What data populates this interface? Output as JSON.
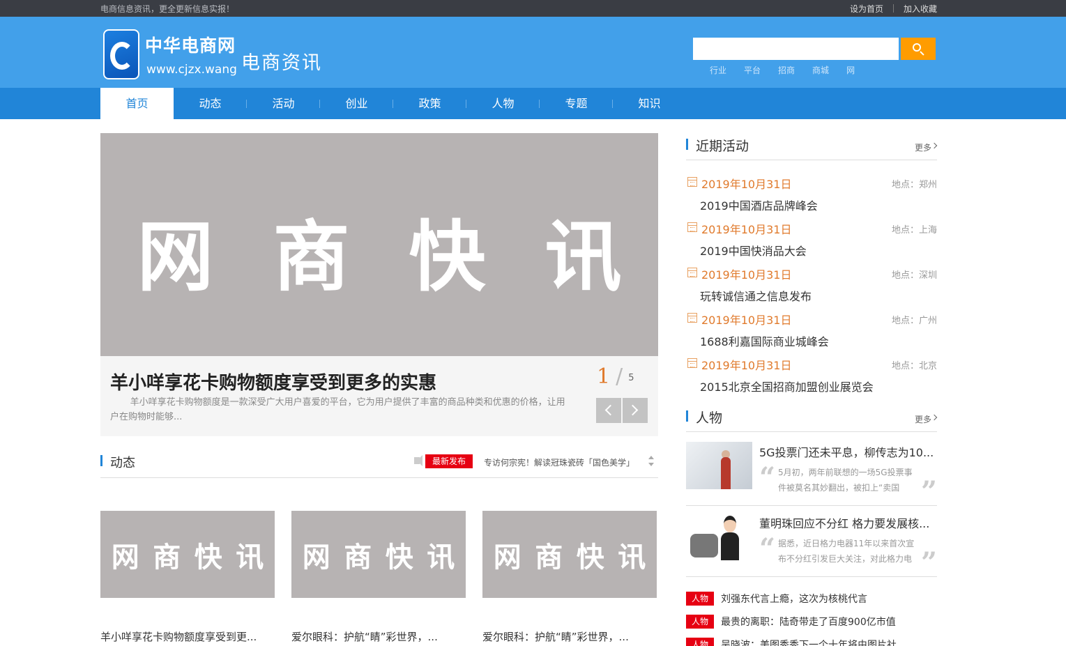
{
  "topbar": {
    "slogan": "电商信息资讯，更全更新信息实报！",
    "set_home": "设为首页",
    "add_fav": "加入收藏"
  },
  "header": {
    "logo_name": "中华电商网",
    "logo_url": "www.cjzx.wang",
    "section": "电商资讯",
    "search_placeholder": "",
    "hot_words": [
      "行业",
      "平台",
      "招商",
      "商城",
      "网"
    ]
  },
  "nav": [
    "首页",
    "动态",
    "活动",
    "创业",
    "政策",
    "人物",
    "专题",
    "知识"
  ],
  "banner": {
    "image_text": [
      "网",
      "商",
      "快",
      "讯"
    ],
    "title": "羊小咩享花卡购物额度享受到更多的实惠",
    "desc": "羊小咩享花卡购物额度是一款深受广大用户喜爱的平台，它为用户提供了丰富的商品种类和优惠的价格，让用户在购物时能够...",
    "current": "1",
    "slash": "/",
    "total": "5"
  },
  "dongtai": {
    "title": "动态",
    "badge": "最新发布",
    "ticker": "专访何宗宪！解读冠珠瓷砖「国色美学」",
    "cards": [
      {
        "img": [
          "网",
          "商",
          "快",
          "讯"
        ],
        "title": "羊小咩享花卡购物额度享受到更..."
      },
      {
        "img": [
          "网",
          "商",
          "快",
          "讯"
        ],
        "title": "爱尔眼科：护航“睛”彩世界，..."
      },
      {
        "img": [
          "网",
          "商",
          "快",
          "讯"
        ],
        "title": "爱尔眼科：护航“睛”彩世界，..."
      }
    ]
  },
  "events": {
    "title": "近期活动",
    "more": "更多",
    "items": [
      {
        "date": "2019年10月31日",
        "loc": "地点：郑州",
        "title": "2019中国酒店品牌峰会"
      },
      {
        "date": "2019年10月31日",
        "loc": "地点：上海",
        "title": "2019中国快消品大会"
      },
      {
        "date": "2019年10月31日",
        "loc": "地点：深圳",
        "title": "玩转诚信通之信息发布"
      },
      {
        "date": "2019年10月31日",
        "loc": "地点：广州",
        "title": "1688利嘉国际商业城峰会"
      },
      {
        "date": "2019年10月31日",
        "loc": "地点：北京",
        "title": "2015北京全国招商加盟创业展览会"
      }
    ]
  },
  "people": {
    "title": "人物",
    "more": "更多",
    "features": [
      {
        "title": "5G投票门还未平息，柳传志为10...",
        "desc": "5月初，两年前联想的一场5G投票事件被莫名其妙翻出，被扣上“卖国"
      },
      {
        "title": "董明珠回应不分红 格力要发展核...",
        "desc": "据悉，近日格力电器11年以来首次宣布不分红引发巨大关注，对此格力电"
      }
    ],
    "list": [
      {
        "tag": "人物",
        "title": "刘强东代言上瘾，这次为核桃代言"
      },
      {
        "tag": "人物",
        "title": "最贵的离职：陆奇带走了百度900亿市值"
      },
      {
        "tag": "人物",
        "title": "吴晓波：美图秀秀下一个十年将由图片社"
      }
    ]
  }
}
